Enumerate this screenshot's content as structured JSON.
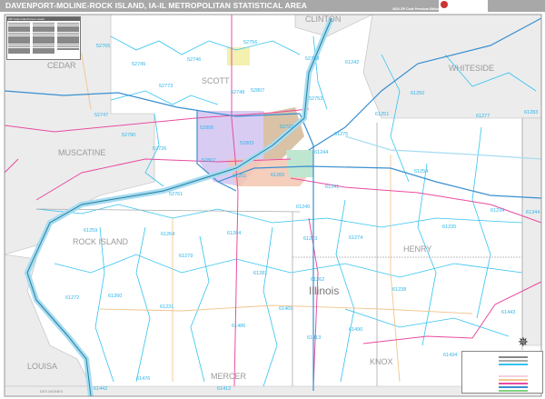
{
  "header": {
    "title": "DAVENPORT-MOLINE-ROCK ISLAND, IA-IL METROPOLITAN STATISTICAL AREA",
    "edition": "2020 ZIP Code Premium Edition",
    "logo_text": "Market MAPS"
  },
  "inset": {
    "title": "ZIP Code Index/Cross Locator"
  },
  "state_label": "Illinois",
  "bottom_label": "DES MOINES",
  "counties": [
    "CLINTON",
    "CEDAR",
    "SCOTT",
    "WHITESIDE",
    "MUSCATINE",
    "ROCK ISLAND",
    "HENRY",
    "LOUISA",
    "MERCER",
    "KNOX"
  ],
  "zips": [
    "52765",
    "52745",
    "52746",
    "52756",
    "52768",
    "61242",
    "52773",
    "52748",
    "52807",
    "52753",
    "52747",
    "52790",
    "52726",
    "52806",
    "52803",
    "52722",
    "61275",
    "61244",
    "61265",
    "52802",
    "61201",
    "61241",
    "61240",
    "52761",
    "61250",
    "61251",
    "61277",
    "61283",
    "61254",
    "61234",
    "61344",
    "61235",
    "61273",
    "61274",
    "61262",
    "61238",
    "61443",
    "61465",
    "61490",
    "61413",
    "61259",
    "61264",
    "61264",
    "61279",
    "61281",
    "61272",
    "61260",
    "61231",
    "61486",
    "61442",
    "61476",
    "61412",
    "61434"
  ],
  "colors": {
    "river": "#a6dcf2",
    "river_line": "#2a7f9a",
    "zip_boundary": "#33c3f0",
    "interstate": "#3a8fd0",
    "us_highway": "#e84ca0",
    "state_road": "#f2c48f",
    "outside_area": "#ececec",
    "urban_davenport": "#d9ccf2",
    "urban_bettendorf": "#d9c2a6",
    "urban_moline": "#f3c6b0"
  },
  "icons": {
    "compass": "compass-rose-icon"
  }
}
